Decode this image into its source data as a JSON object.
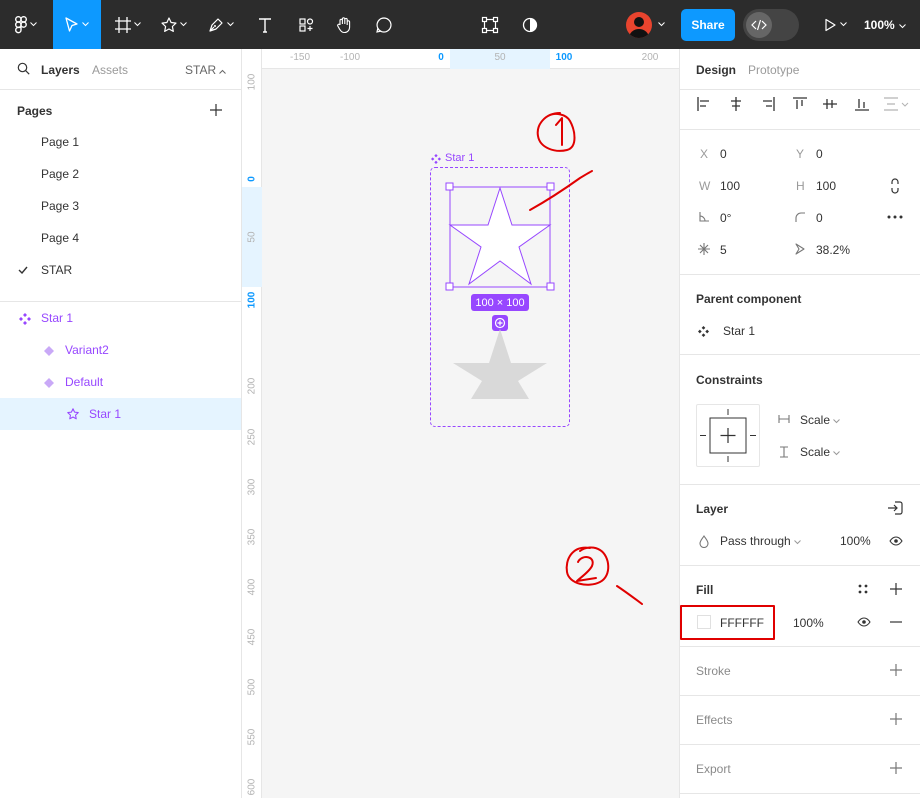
{
  "toolbar": {
    "share_label": "Share",
    "zoom": "100%"
  },
  "left_panel": {
    "tabs": {
      "layers": "Layers",
      "assets": "Assets",
      "page_selector": "STAR"
    },
    "pages_title": "Pages",
    "pages": [
      "Page 1",
      "Page 2",
      "Page 3",
      "Page 4",
      "STAR"
    ],
    "current_page": "STAR",
    "layers": {
      "component_set": "Star 1",
      "variant2": "Variant2",
      "default": "Default",
      "child": "Star 1"
    }
  },
  "canvas": {
    "ruler_top": [
      "-150",
      "-100",
      "0",
      "50",
      "100",
      "200"
    ],
    "ruler_left": [
      "100",
      "0",
      "50",
      "100",
      "200",
      "250",
      "300",
      "350",
      "400",
      "450",
      "500",
      "550",
      "600"
    ],
    "frame_label": "Star 1",
    "size_badge": "100 × 100"
  },
  "right_panel": {
    "tabs": {
      "design": "Design",
      "prototype": "Prototype"
    },
    "position": {
      "x_label": "X",
      "x": "0",
      "y_label": "Y",
      "y": "0",
      "w_label": "W",
      "w": "100",
      "h_label": "H",
      "h": "100",
      "rotation": "0°",
      "corner_radius": "0",
      "count": "5",
      "ratio": "38.2%"
    },
    "parent_component": {
      "title": "Parent component",
      "name": "Star 1"
    },
    "constraints": {
      "title": "Constraints",
      "horizontal": "Scale",
      "vertical": "Scale"
    },
    "layer": {
      "title": "Layer",
      "blend": "Pass through",
      "opacity": "100%"
    },
    "fill": {
      "title": "Fill",
      "hex": "FFFFFF",
      "opacity": "100%",
      "swatch_color": "#ffffff"
    },
    "stroke": {
      "title": "Stroke"
    },
    "effects": {
      "title": "Effects"
    },
    "export": {
      "title": "Export"
    }
  },
  "colors": {
    "accent": "#0d99ff",
    "component_purple": "#9747ff",
    "annotation_red": "#e00000"
  }
}
